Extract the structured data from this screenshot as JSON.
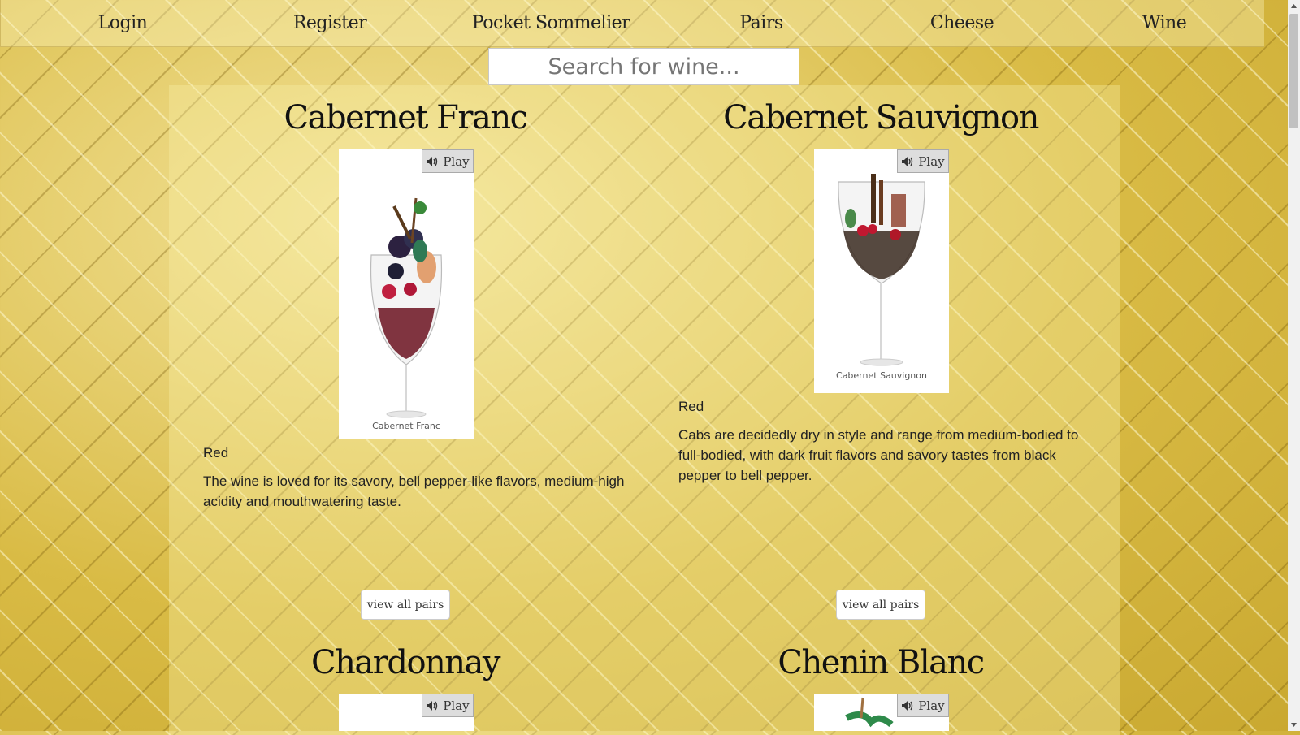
{
  "nav": {
    "items": [
      {
        "label": "Login"
      },
      {
        "label": "Register"
      },
      {
        "label": "Pocket Sommelier"
      },
      {
        "label": "Pairs"
      },
      {
        "label": "Cheese"
      },
      {
        "label": "Wine"
      }
    ]
  },
  "search": {
    "placeholder": "Search for wine...",
    "value": ""
  },
  "wines": [
    {
      "name": "Cabernet Franc",
      "play_label": "Play",
      "image_caption": "Cabernet Franc",
      "type": "Red",
      "description": "The wine is loved for its savory, bell pepper-like flavors, medium-high acidity and mouthwatering taste.",
      "pairs_label": "view all pairs"
    },
    {
      "name": "Cabernet Sauvignon",
      "play_label": "Play",
      "image_caption": "Cabernet Sauvignon",
      "type": "Red",
      "description": "Cabs are decidedly dry in style and range from medium-bodied to full-bodied, with dark fruit flavors and savory tastes from black pepper to bell pepper.",
      "pairs_label": "view all pairs"
    },
    {
      "name": "Chardonnay",
      "play_label": "Play"
    },
    {
      "name": "Chenin Blanc",
      "play_label": "Play"
    }
  ],
  "colors": {
    "background_gold": "#e2c95a",
    "panel": "#faf0aa",
    "button_bg": "#ffffff",
    "text": "#222222"
  },
  "icons": {
    "play": "speaker-icon",
    "scroll_up": "triangle-up-icon",
    "scroll_down": "triangle-down-icon"
  }
}
